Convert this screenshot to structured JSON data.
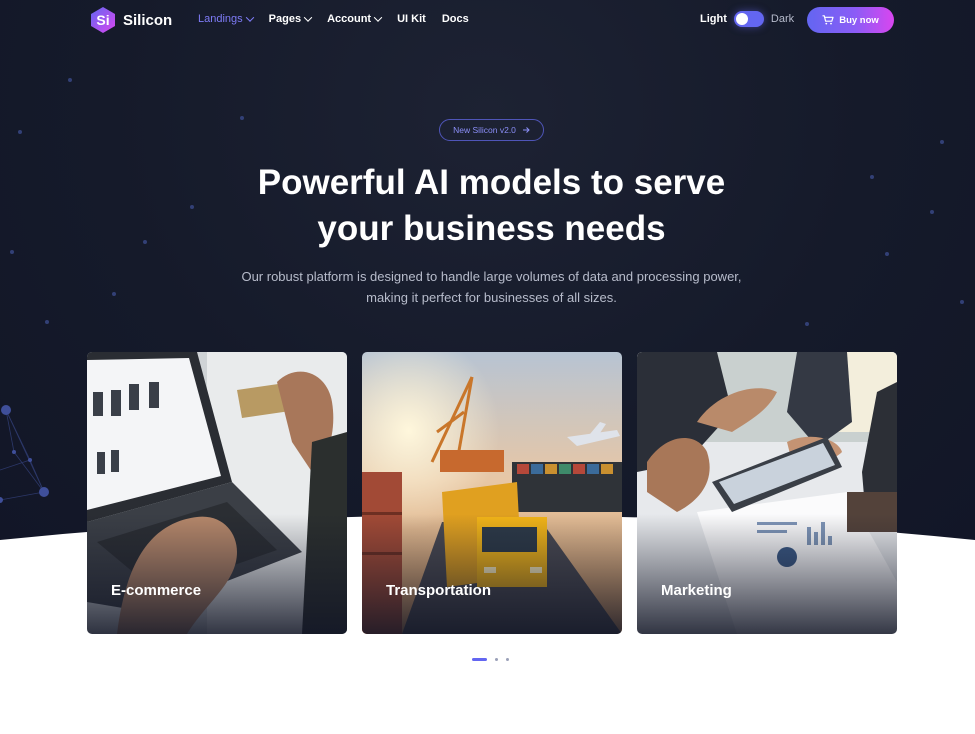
{
  "brand": {
    "logo_text": "Si",
    "name": "Silicon"
  },
  "nav": {
    "items": [
      {
        "label": "Landings",
        "has_dropdown": true,
        "active": true
      },
      {
        "label": "Pages",
        "has_dropdown": true
      },
      {
        "label": "Account",
        "has_dropdown": true
      },
      {
        "label": "UI Kit",
        "has_dropdown": false
      },
      {
        "label": "Docs",
        "has_dropdown": false
      }
    ]
  },
  "theme": {
    "light_label": "Light",
    "dark_label": "Dark",
    "mode": "dark"
  },
  "buy_button": {
    "label": "Buy now",
    "icon": "cart-icon"
  },
  "hero": {
    "badge": "New Silicon v2.0",
    "title_line1": "Powerful AI models to serve",
    "title_line2": "your business needs",
    "description_line1": "Our robust platform is designed to handle large volumes of data and processing power,",
    "description_line2": "making it perfect for businesses of all sizes."
  },
  "cards": [
    {
      "label": "E-commerce"
    },
    {
      "label": "Transportation"
    },
    {
      "label": "Marketing"
    }
  ],
  "pagination": {
    "current": 1,
    "total": 3
  },
  "colors": {
    "accent": "#6366f1",
    "hero_bg": "#151a2a",
    "accent_pink": "#d946ef"
  }
}
